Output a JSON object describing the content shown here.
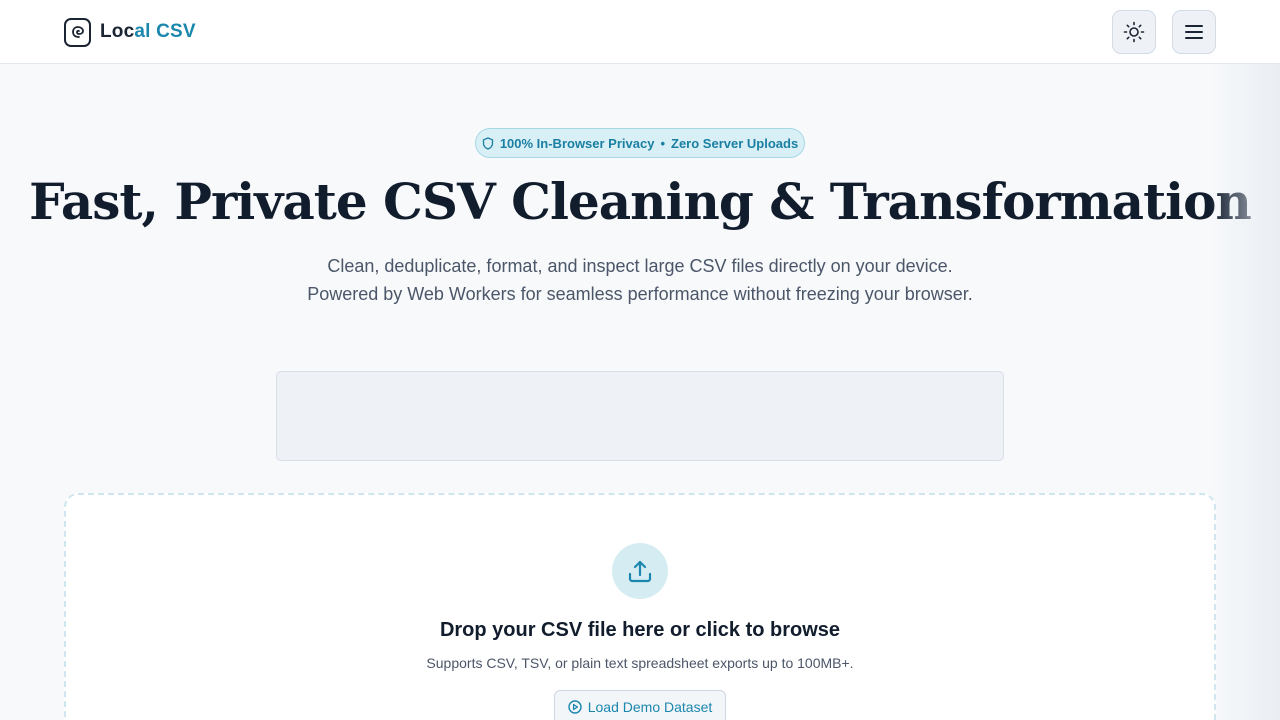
{
  "header": {
    "logo_text_main": "Loc",
    "logo_text_accent": "al CSV",
    "theme_toggle_icon": "sun-icon",
    "menu_icon": "hamburger-menu-icon"
  },
  "hero": {
    "badge_icon": "shield-icon",
    "badge_part1": "100% In-Browser Privacy",
    "badge_separator": "•",
    "badge_part2": "Zero Server Uploads",
    "title": "Fast, Private CSV Cleaning & Transformation",
    "subtitle_line1": "Clean, deduplicate, format, and inspect large CSV files directly on your device.",
    "subtitle_line2": "Powered by Web Workers for seamless performance without freezing your browser."
  },
  "dropzone": {
    "icon": "upload-icon",
    "title": "Drop your CSV file here or click to browse",
    "subtitle": "Supports CSV, TSV, or plain text spreadsheet exports up to 100MB+.",
    "demo_button_icon": "play-circle-icon",
    "demo_button_label": "Load Demo Dataset"
  },
  "colors": {
    "accent": "#1b87ad",
    "background": "#f7f9fb",
    "text_primary": "#111c2d",
    "badge_bg": "#d7eff5"
  }
}
